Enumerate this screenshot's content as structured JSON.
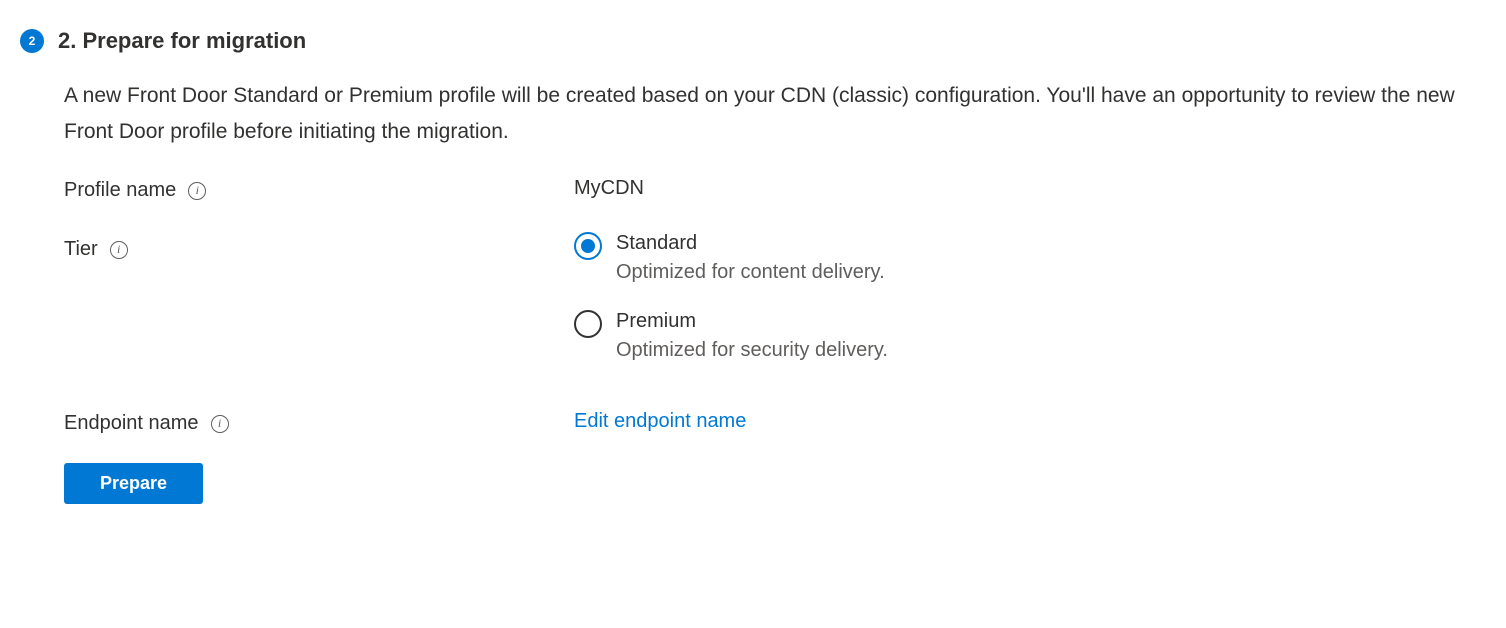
{
  "step": {
    "number": "2",
    "title": "2. Prepare for migration",
    "description": "A new Front Door Standard or Premium profile will be created based on your CDN (classic) configuration. You'll have an opportunity to review the new Front Door profile before initiating the migration."
  },
  "form": {
    "profile_name": {
      "label": "Profile name",
      "value": "MyCDN"
    },
    "tier": {
      "label": "Tier",
      "options": [
        {
          "label": "Standard",
          "description": "Optimized for content delivery.",
          "selected": true
        },
        {
          "label": "Premium",
          "description": "Optimized for security delivery.",
          "selected": false
        }
      ]
    },
    "endpoint_name": {
      "label": "Endpoint name",
      "link_text": "Edit endpoint name"
    }
  },
  "actions": {
    "prepare_label": "Prepare"
  }
}
